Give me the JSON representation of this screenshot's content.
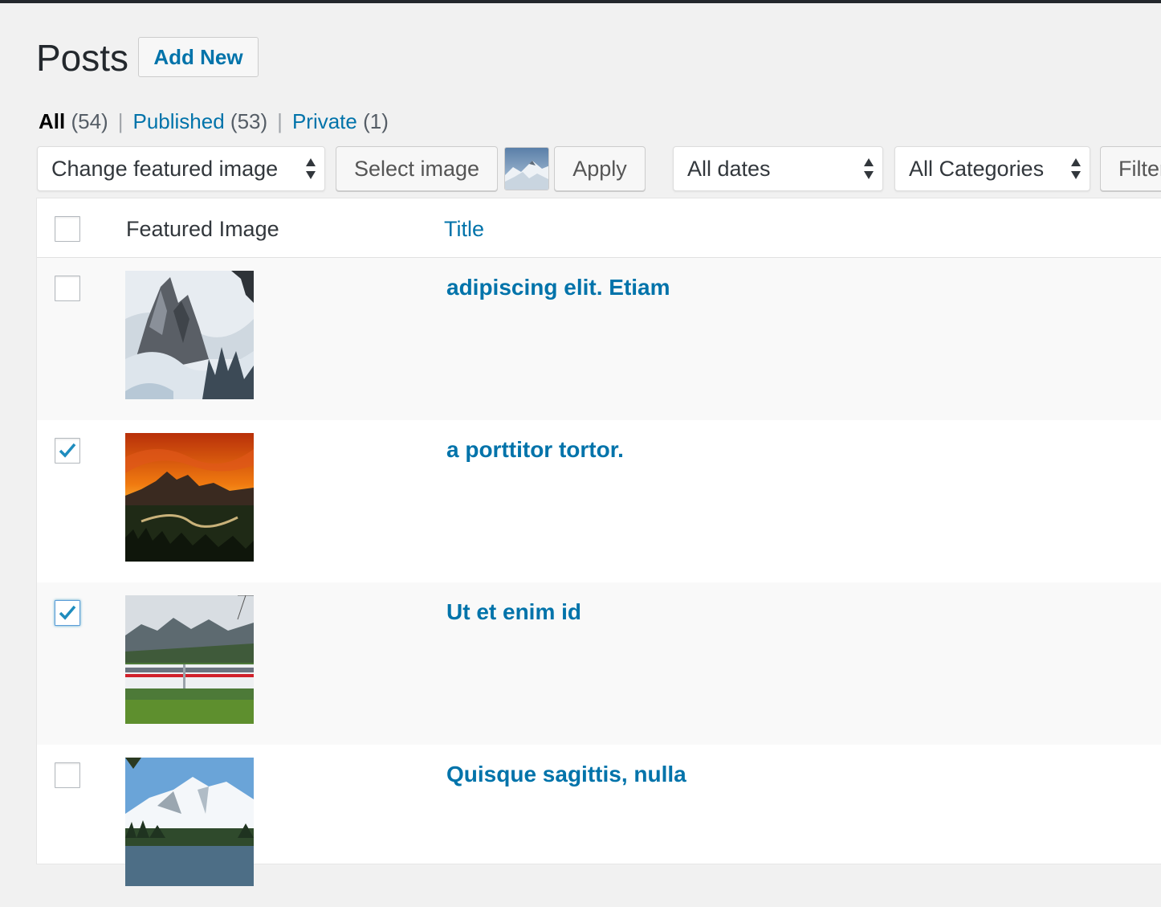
{
  "page": {
    "title": "Posts",
    "add_new_label": "Add New"
  },
  "filters": {
    "all_label": "All",
    "all_count": "(54)",
    "published_label": "Published",
    "published_count": "(53)",
    "private_label": "Private",
    "private_count": "(1)",
    "separator": "|"
  },
  "tablenav": {
    "bulk_action": "Change featured image",
    "select_image_label": "Select image",
    "apply_label": "Apply",
    "dates": "All dates",
    "categories": "All Categories",
    "filter_label": "Filter"
  },
  "table": {
    "columns": [
      "Featured Image",
      "Title"
    ],
    "rows": [
      {
        "title": "adipiscing elit. Etiam",
        "checked": false,
        "image": "snowy-mountain-peak-image"
      },
      {
        "title": "a porttitor tortor.",
        "checked": true,
        "image": "sunset-valley-image"
      },
      {
        "title": "Ut et enim id",
        "checked": true,
        "image": "train-in-mountains-image"
      },
      {
        "title": "Quisque sagittis, nulla",
        "checked": false,
        "image": "snow-mountain-lake-image"
      }
    ]
  },
  "colors": {
    "link": "#0073aa",
    "background": "#f1f1f1",
    "checkmark": "#1e8cbe"
  }
}
